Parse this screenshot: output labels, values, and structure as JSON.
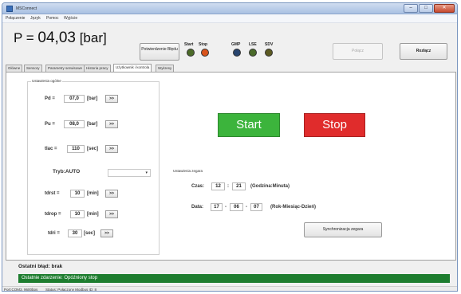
{
  "window": {
    "title": "MSConnect",
    "minimize": "–",
    "maximize": "□",
    "close": "✕"
  },
  "menu": [
    "Połączenie",
    "Język",
    "Pomoc",
    "Wyjście"
  ],
  "header": {
    "pressure_prefix": "P =",
    "pressure_value": "04,03",
    "pressure_unit": "[bar]",
    "confirm_button": "Potwierdzenie Błędu",
    "leds": [
      {
        "label": "Start",
        "color": "#4c6b28"
      },
      {
        "label": "Stop",
        "color": "#d9541c"
      },
      {
        "label": "GMP",
        "color": "#27446e"
      },
      {
        "label": "LSE",
        "color": "#4a6a2a"
      },
      {
        "label": "SDV",
        "color": "#5c5a22"
      }
    ],
    "connect_button": "Połącz",
    "disconnect_button": "Rozłącz"
  },
  "tabs": [
    "Główne",
    "Sensory",
    "Parametry serwisowe",
    "Historia pracy",
    "Użytkownik i kontrola",
    "Wykresy"
  ],
  "active_tab": 4,
  "general": {
    "title": "Ustawienia ogólne",
    "rows": [
      {
        "label": "Pd =",
        "value": "07,0",
        "unit": "[bar]",
        "button": ">>"
      },
      {
        "label": "Pu =",
        "value": "08,0",
        "unit": "[bar]",
        "button": ">>"
      },
      {
        "label": "tlac =",
        "value": "110",
        "unit": "[sec]",
        "button": ">>"
      },
      {
        "label": "Tryb:AUTO",
        "value": "",
        "unit": "",
        "button": ""
      },
      {
        "label": "tdrst =",
        "value": "10",
        "unit": "[min]",
        "button": ">>"
      },
      {
        "label": "tdrop =",
        "value": "10",
        "unit": "[min]",
        "button": ">>"
      },
      {
        "label": "tdri =",
        "value": "30",
        "unit": "[sec]",
        "button": ">>"
      }
    ]
  },
  "control": {
    "start_label": "Start",
    "start_color": "#3cb43c",
    "stop_label": "Stop",
    "stop_color": "#e02c2c"
  },
  "clock": {
    "title": "Ustawienia zegara",
    "time_label": "Czas:",
    "hour": "12",
    "minute": "21",
    "time_hint": "(Godzina:Minuta)",
    "date_label": "Data:",
    "year": "17",
    "month": "06",
    "day": "07",
    "date_hint": "(Rok-Miesiąc-Dzień)",
    "sync_button": "Synchronizacja zegara"
  },
  "status": {
    "last_error": "Ostatni błąd: brak",
    "last_event": "Ostatnie zdarzenie: Opóźniony stop",
    "event_color": "#1e7d2f",
    "bar": [
      "Port:COM3, 9600bps",
      "Status: Połączony Modbus ID: 8"
    ]
  }
}
